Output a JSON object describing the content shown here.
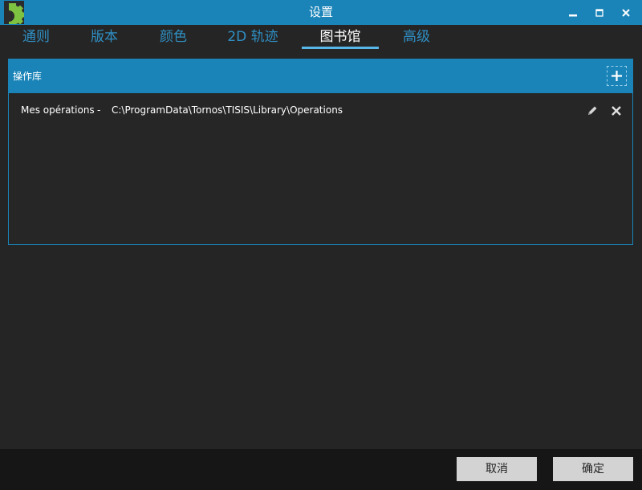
{
  "window": {
    "title": "设置",
    "accent_color": "#1a84b8",
    "icons": {
      "logo": "gear-logo-icon",
      "minimize": "minimize-icon",
      "maximize": "maximize-icon",
      "close": "close-icon"
    }
  },
  "tabs": [
    {
      "label": "通则",
      "active": false
    },
    {
      "label": "版本",
      "active": false
    },
    {
      "label": "颜色",
      "active": false
    },
    {
      "label": "2D 轨迹",
      "active": false
    },
    {
      "label": "图书馆",
      "active": true
    },
    {
      "label": "高级",
      "active": false
    }
  ],
  "panel": {
    "title": "操作库",
    "add_icon": "plus-icon",
    "items": [
      {
        "name": "Mes opérations",
        "separator": "-",
        "path": "C:\\ProgramData\\Tornos\\TISIS\\Library\\Operations",
        "edit_icon": "pencil-icon",
        "delete_icon": "close-icon"
      }
    ]
  },
  "footer": {
    "cancel_label": "取消",
    "ok_label": "确定"
  }
}
